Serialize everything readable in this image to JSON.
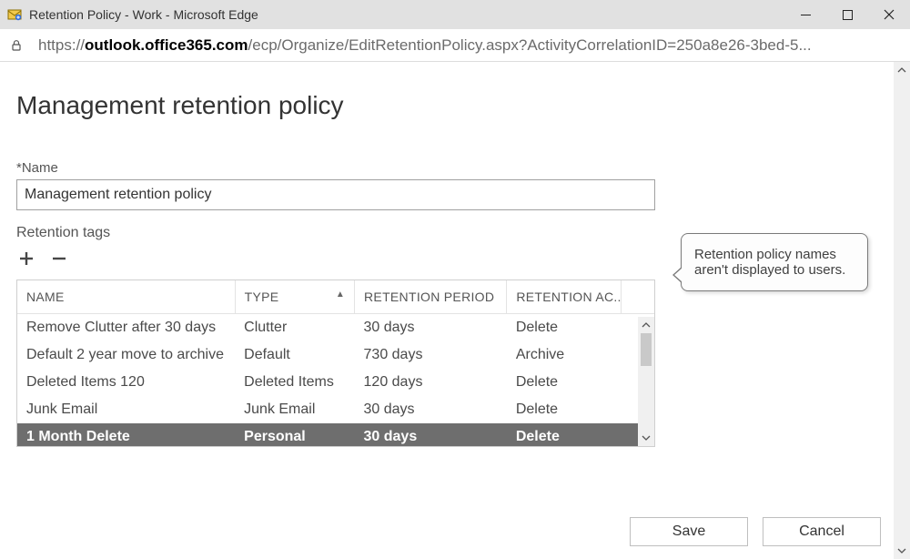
{
  "window": {
    "title": "Retention Policy - Work - Microsoft Edge"
  },
  "addressbar": {
    "scheme": "https://",
    "host": "outlook.office365.com",
    "path": "/ecp/Organize/EditRetentionPolicy.aspx?ActivityCorrelationID=250a8e26-3bed-5..."
  },
  "page": {
    "title": "Management retention policy",
    "name_label": "*Name",
    "name_value": "Management retention policy",
    "retention_tags_label": "Retention tags",
    "tooltip": "Retention policy names aren't displayed to users."
  },
  "columns": {
    "name": "NAME",
    "type": "TYPE",
    "period": "RETENTION PERIOD",
    "action": "RETENTION AC..."
  },
  "rows": [
    {
      "name": "Remove Clutter after 30 days",
      "type": "Clutter",
      "period": "30 days",
      "action": "Delete",
      "selected": false
    },
    {
      "name": "Default 2 year move to archive",
      "type": "Default",
      "period": "730 days",
      "action": "Archive",
      "selected": false
    },
    {
      "name": "Deleted Items 120",
      "type": "Deleted Items",
      "period": "120 days",
      "action": "Delete",
      "selected": false
    },
    {
      "name": "Junk Email",
      "type": "Junk Email",
      "period": "30 days",
      "action": "Delete",
      "selected": false
    },
    {
      "name": "1 Month Delete",
      "type": "Personal",
      "period": "30 days",
      "action": "Delete",
      "selected": true
    }
  ],
  "buttons": {
    "save": "Save",
    "cancel": "Cancel"
  }
}
